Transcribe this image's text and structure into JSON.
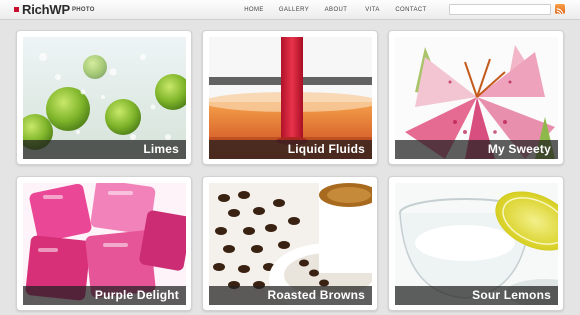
{
  "header": {
    "brand": "RichWP",
    "brand_sub": "PHOTO",
    "nav": [
      {
        "label": "HOME"
      },
      {
        "label": "GALLERY"
      },
      {
        "label": "ABOUT"
      },
      {
        "label": "VITA"
      },
      {
        "label": "CONTACT"
      }
    ],
    "search_value": "",
    "icons": {
      "logo": "logo-square-icon",
      "rss": "rss-icon"
    },
    "colors": {
      "brand_mark": "#c8102e",
      "rss": "#e8741f"
    }
  },
  "gallery": {
    "items": [
      {
        "title": "Limes",
        "image": "limes-in-water"
      },
      {
        "title": "Liquid Fluids",
        "image": "red-drink-pour"
      },
      {
        "title": "My Sweety",
        "image": "pink-lily-flower"
      },
      {
        "title": "Purple Delight",
        "image": "pink-ice-cubes"
      },
      {
        "title": "Roasted Browns",
        "image": "coffee-beans-cup"
      },
      {
        "title": "Sour Lemons",
        "image": "lemon-slice-glass"
      }
    ]
  }
}
